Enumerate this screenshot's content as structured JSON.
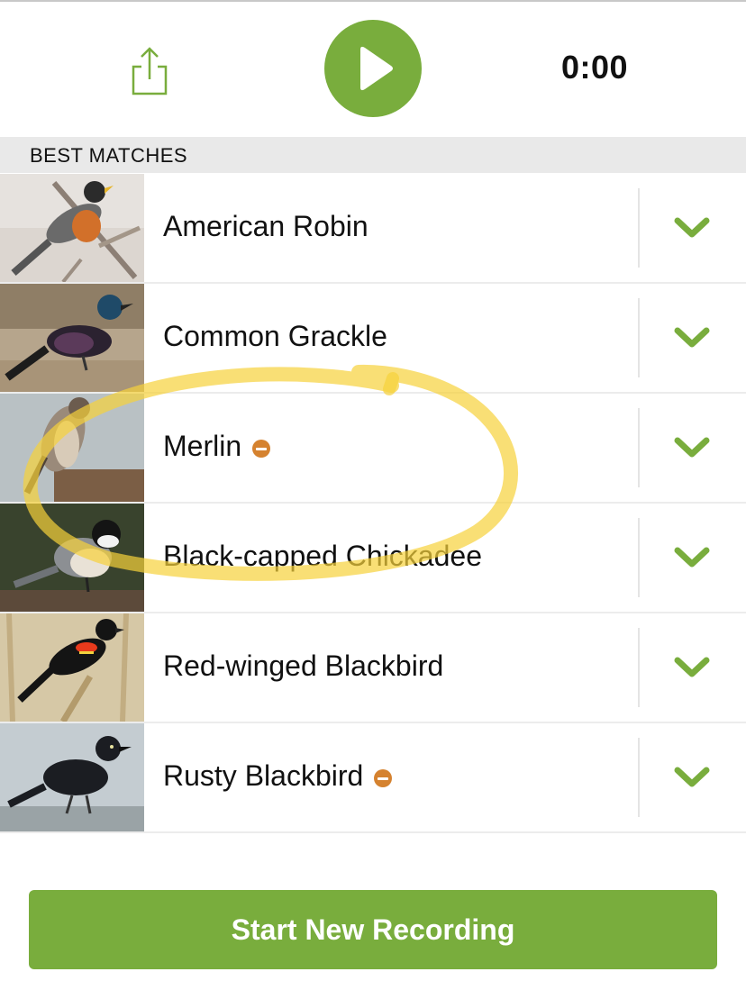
{
  "player": {
    "timer": "0:00"
  },
  "section": {
    "title": "BEST MATCHES"
  },
  "matches": [
    {
      "name": "American Robin",
      "rare": false
    },
    {
      "name": "Common Grackle",
      "rare": false
    },
    {
      "name": "Merlin",
      "rare": true
    },
    {
      "name": "Black-capped Chickadee",
      "rare": false
    },
    {
      "name": "Red-winged Blackbird",
      "rare": false
    },
    {
      "name": "Rusty Blackbird",
      "rare": true
    }
  ],
  "footer": {
    "start_label": "Start New Recording"
  },
  "colors": {
    "accent": "#79ad3d",
    "rare": "#d5822f",
    "highlighter": "#f6d23a"
  }
}
